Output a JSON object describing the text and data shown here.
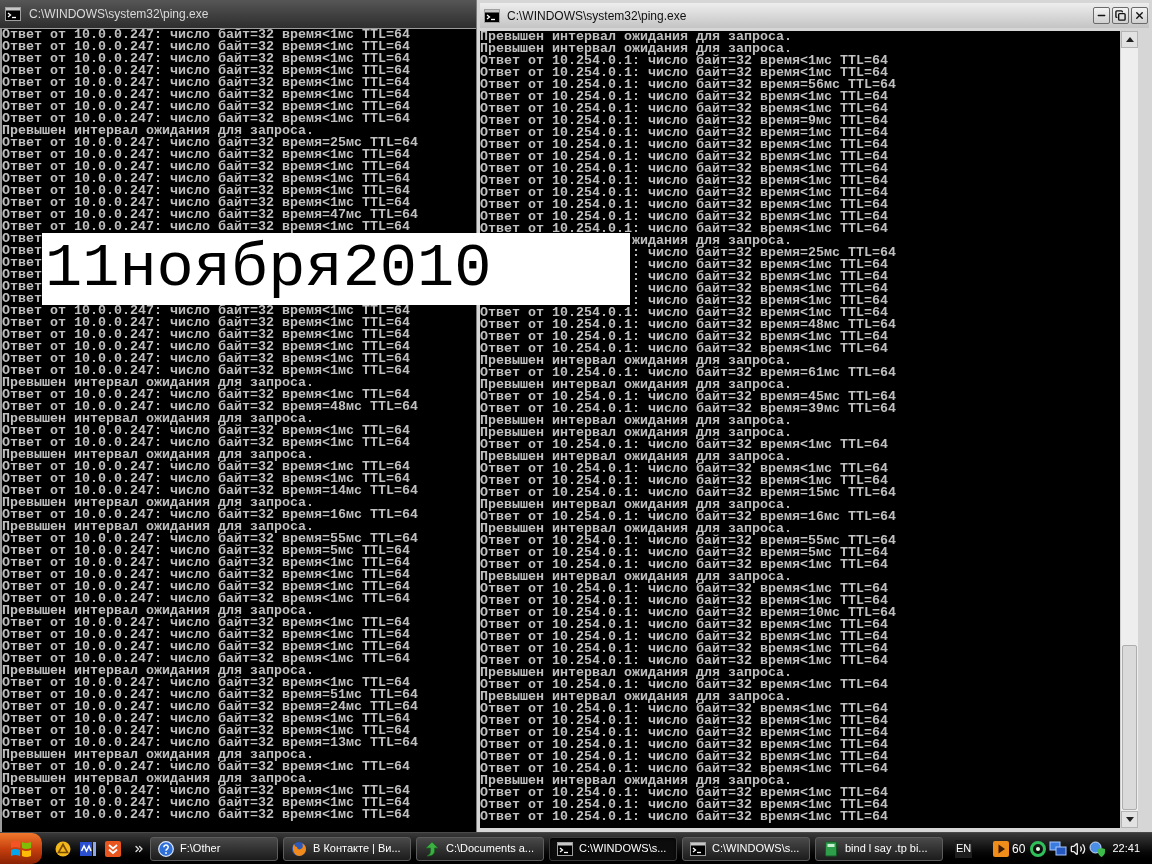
{
  "windows": [
    {
      "title": "C:\\WINDOWS\\system32\\ping.exe",
      "active": false,
      "lines": [
        {
          "kind": "line",
          "text": "Ответ от 10.0.0.247: число байт=32 время<1мс TTL=64"
        },
        {
          "kind": "line",
          "text": "Ответ от 10.0.0.247: число байт=32 время<1мс TTL=64"
        },
        {
          "kind": "line",
          "text": "Ответ от 10.0.0.247: число байт=32 время<1мс TTL=64"
        },
        {
          "kind": "line",
          "text": "Ответ от 10.0.0.247: число байт=32 время<1мс TTL=64"
        },
        {
          "kind": "line",
          "text": "Ответ от 10.0.0.247: число байт=32 время<1мс TTL=64"
        },
        {
          "kind": "line",
          "text": "Ответ от 10.0.0.247: число байт=32 время<1мс TTL=64"
        },
        {
          "kind": "line",
          "text": "Ответ от 10.0.0.247: число байт=32 время<1мс TTL=64"
        },
        {
          "kind": "line",
          "text": "Ответ от 10.0.0.247: число байт=32 время<1мс TTL=64"
        },
        {
          "kind": "line",
          "text": "Превышен интервал ожидания для запроса."
        },
        {
          "kind": "line",
          "text": "Ответ от 10.0.0.247: число байт=32 время=25мс TTL=64"
        },
        {
          "kind": "line",
          "text": "Ответ от 10.0.0.247: число байт=32 время<1мс TTL=64"
        },
        {
          "kind": "line",
          "text": "Ответ от 10.0.0.247: число байт=32 время<1мс TTL=64"
        },
        {
          "kind": "line",
          "text": "Ответ от 10.0.0.247: число байт=32 время<1мс TTL=64"
        },
        {
          "kind": "line",
          "text": "Ответ от 10.0.0.247: число байт=32 время<1мс TTL=64"
        },
        {
          "kind": "line",
          "text": "Ответ от 10.0.0.247: число байт=32 время<1мс TTL=64"
        },
        {
          "kind": "line",
          "text": "Ответ от 10.0.0.247: число байт=32 время=47мс TTL=64"
        },
        {
          "kind": "line",
          "text": "Ответ от 10.0.0.247: число байт=32 время<1мс TTL=64"
        },
        {
          "kind": "line",
          "text": "Ответ"
        },
        {
          "kind": "line",
          "text": "Ответ"
        },
        {
          "kind": "line",
          "text": "Ответ"
        },
        {
          "kind": "line",
          "text": "Ответ"
        },
        {
          "kind": "line",
          "text": "Ответ"
        },
        {
          "kind": "line",
          "text": "Ответ"
        },
        {
          "kind": "line",
          "text": "Ответ от 10.0.0.247: число байт=32 время<1мс TTL=64"
        },
        {
          "kind": "line",
          "text": "Ответ от 10.0.0.247: число байт=32 время<1мс TTL=64"
        },
        {
          "kind": "line",
          "text": "Ответ от 10.0.0.247: число байт=32 время<1мс TTL=64"
        },
        {
          "kind": "line",
          "text": "Ответ от 10.0.0.247: число байт=32 время<1мс TTL=64"
        },
        {
          "kind": "line",
          "text": "Ответ от 10.0.0.247: число байт=32 время<1мс TTL=64"
        },
        {
          "kind": "line",
          "text": "Ответ от 10.0.0.247: число байт=32 время<1мс TTL=64"
        },
        {
          "kind": "line",
          "text": "Превышен интервал ожидания для запроса."
        },
        {
          "kind": "line",
          "text": "Ответ от 10.0.0.247: число байт=32 время<1мс TTL=64"
        },
        {
          "kind": "line",
          "text": "Ответ от 10.0.0.247: число байт=32 время=48мс TTL=64"
        },
        {
          "kind": "line",
          "text": "Превышен интервал ожидания для запроса."
        },
        {
          "kind": "line",
          "text": "Ответ от 10.0.0.247: число байт=32 время<1мс TTL=64"
        },
        {
          "kind": "line",
          "text": "Ответ от 10.0.0.247: число байт=32 время<1мс TTL=64"
        },
        {
          "kind": "line",
          "text": "Превышен интервал ожидания для запроса."
        },
        {
          "kind": "line",
          "text": "Ответ от 10.0.0.247: число байт=32 время<1мс TTL=64"
        },
        {
          "kind": "line",
          "text": "Ответ от 10.0.0.247: число байт=32 время<1мс TTL=64"
        },
        {
          "kind": "line",
          "text": "Ответ от 10.0.0.247: число байт=32 время=14мс TTL=64"
        },
        {
          "kind": "line",
          "text": "Превышен интервал ожидания для запроса."
        },
        {
          "kind": "line",
          "text": "Ответ от 10.0.0.247: число байт=32 время=16мс TTL=64"
        },
        {
          "kind": "line",
          "text": "Превышен интервал ожидания для запроса."
        },
        {
          "kind": "line",
          "text": "Ответ от 10.0.0.247: число байт=32 время=55мс TTL=64"
        },
        {
          "kind": "line",
          "text": "Ответ от 10.0.0.247: число байт=32 время=5мс TTL=64"
        },
        {
          "kind": "line",
          "text": "Ответ от 10.0.0.247: число байт=32 время<1мс TTL=64"
        },
        {
          "kind": "line",
          "text": "Ответ от 10.0.0.247: число байт=32 время<1мс TTL=64"
        },
        {
          "kind": "line",
          "text": "Ответ от 10.0.0.247: число байт=32 время<1мс TTL=64"
        },
        {
          "kind": "line",
          "text": "Ответ от 10.0.0.247: число байт=32 время<1мс TTL=64"
        },
        {
          "kind": "line",
          "text": "Превышен интервал ожидания для запроса."
        },
        {
          "kind": "line",
          "text": "Ответ от 10.0.0.247: число байт=32 время<1мс TTL=64"
        },
        {
          "kind": "line",
          "text": "Ответ от 10.0.0.247: число байт=32 время<1мс TTL=64"
        },
        {
          "kind": "line",
          "text": "Ответ от 10.0.0.247: число байт=32 время<1мс TTL=64"
        },
        {
          "kind": "line",
          "text": "Ответ от 10.0.0.247: число байт=32 время<1мс TTL=64"
        },
        {
          "kind": "line",
          "text": "Превышен интервал ожидания для запроса."
        },
        {
          "kind": "line",
          "text": "Ответ от 10.0.0.247: число байт=32 время<1мс TTL=64"
        },
        {
          "kind": "line",
          "text": "Ответ от 10.0.0.247: число байт=32 время=51мс TTL=64"
        },
        {
          "kind": "line",
          "text": "Ответ от 10.0.0.247: число байт=32 время=24мс TTL=64"
        },
        {
          "kind": "line",
          "text": "Ответ от 10.0.0.247: число байт=32 время<1мс TTL=64"
        },
        {
          "kind": "line",
          "text": "Ответ от 10.0.0.247: число байт=32 время<1мс TTL=64"
        },
        {
          "kind": "line",
          "text": "Ответ от 10.0.0.247: число байт=32 время=13мс TTL=64"
        },
        {
          "kind": "line",
          "text": "Превышен интервал ожидания для запроса."
        },
        {
          "kind": "line",
          "text": "Ответ от 10.0.0.247: число байт=32 время<1мс TTL=64"
        },
        {
          "kind": "line",
          "text": "Превышен интервал ожидания для запроса."
        },
        {
          "kind": "line",
          "text": "Ответ от 10.0.0.247: число байт=32 время<1мс TTL=64"
        },
        {
          "kind": "line",
          "text": "Ответ от 10.0.0.247: число байт=32 время<1мс TTL=64"
        },
        {
          "kind": "line",
          "text": "Ответ от 10.0.0.247: число байт=32 время<1мс TTL=64"
        }
      ]
    },
    {
      "title": "C:\\WINDOWS\\system32\\ping.exe",
      "active": true,
      "lines": [
        {
          "kind": "line",
          "text": "Превышен интервал ожидания для запроса."
        },
        {
          "kind": "line",
          "text": "Превышен интервал ожидания для запроса."
        },
        {
          "kind": "line",
          "text": "Ответ от 10.254.0.1: число байт=32 время<1мс TTL=64"
        },
        {
          "kind": "line",
          "text": "Ответ от 10.254.0.1: число байт=32 время<1мс TTL=64"
        },
        {
          "kind": "line",
          "text": "Ответ от 10.254.0.1: число байт=32 время=56мс TTL=64"
        },
        {
          "kind": "line",
          "text": "Ответ от 10.254.0.1: число байт=32 время<1мс TTL=64"
        },
        {
          "kind": "line",
          "text": "Ответ от 10.254.0.1: число байт=32 время<1мс TTL=64"
        },
        {
          "kind": "line",
          "text": "Ответ от 10.254.0.1: число байт=32 время=9мс TTL=64"
        },
        {
          "kind": "line",
          "text": "Ответ от 10.254.0.1: число байт=32 время=1мс TTL=64"
        },
        {
          "kind": "line",
          "text": "Ответ от 10.254.0.1: число байт=32 время<1мс TTL=64"
        },
        {
          "kind": "line",
          "text": "Ответ от 10.254.0.1: число байт=32 время<1мс TTL=64"
        },
        {
          "kind": "line",
          "text": "Ответ от 10.254.0.1: число байт=32 время<1мс TTL=64"
        },
        {
          "kind": "line",
          "text": "Ответ от 10.254.0.1: число байт=32 время<1мс TTL=64"
        },
        {
          "kind": "line",
          "text": "Ответ от 10.254.0.1: число байт=32 время<1мс TTL=64"
        },
        {
          "kind": "line",
          "text": "Ответ от 10.254.0.1: число байт=32 время<1мс TTL=64"
        },
        {
          "kind": "line",
          "text": "Ответ от 10.254.0.1: число байт=32 время<1мс TTL=64"
        },
        {
          "kind": "line",
          "text": "Ответ от 10.254.0.1: число байт=32 время<1мс TTL=64"
        },
        {
          "kind": "tail",
          "text": "жидания для запроса."
        },
        {
          "kind": "tail",
          "text": ": число байт=32 время=25мс TTL=64"
        },
        {
          "kind": "tail",
          "text": ": число байт=32 время<1мс TTL=64"
        },
        {
          "kind": "tail",
          "text": ": число байт=32 время<1мс TTL=64"
        },
        {
          "kind": "tail",
          "text": ": число байт=32 время<1мс TTL=64"
        },
        {
          "kind": "tail",
          "text": ": число байт=32 время<1мс TTL=64"
        },
        {
          "kind": "line",
          "text": "Ответ от 10.254.0.1: число байт=32 время<1мс TTL=64"
        },
        {
          "kind": "line",
          "text": "Ответ от 10.254.0.1: число байт=32 время=48мс TTL=64"
        },
        {
          "kind": "line",
          "text": "Ответ от 10.254.0.1: число байт=32 время<1мс TTL=64"
        },
        {
          "kind": "line",
          "text": "Ответ от 10.254.0.1: число байт=32 время<1мс TTL=64"
        },
        {
          "kind": "line",
          "text": "Превышен интервал ожидания для запроса."
        },
        {
          "kind": "line",
          "text": "Ответ от 10.254.0.1: число байт=32 время=61мс TTL=64"
        },
        {
          "kind": "line",
          "text": "Превышен интервал ожидания для запроса."
        },
        {
          "kind": "line",
          "text": "Ответ от 10.254.0.1: число байт=32 время=45мс TTL=64"
        },
        {
          "kind": "line",
          "text": "Ответ от 10.254.0.1: число байт=32 время=39мс TTL=64"
        },
        {
          "kind": "line",
          "text": "Превышен интервал ожидания для запроса."
        },
        {
          "kind": "line",
          "text": "Превышен интервал ожидания для запроса."
        },
        {
          "kind": "line",
          "text": "Ответ от 10.254.0.1: число байт=32 время<1мс TTL=64"
        },
        {
          "kind": "line",
          "text": "Превышен интервал ожидания для запроса."
        },
        {
          "kind": "line",
          "text": "Ответ от 10.254.0.1: число байт=32 время<1мс TTL=64"
        },
        {
          "kind": "line",
          "text": "Ответ от 10.254.0.1: число байт=32 время<1мс TTL=64"
        },
        {
          "kind": "line",
          "text": "Ответ от 10.254.0.1: число байт=32 время=15мс TTL=64"
        },
        {
          "kind": "line",
          "text": "Превышен интервал ожидания для запроса."
        },
        {
          "kind": "line",
          "text": "Ответ от 10.254.0.1: число байт=32 время=16мс TTL=64"
        },
        {
          "kind": "line",
          "text": "Превышен интервал ожидания для запроса."
        },
        {
          "kind": "line",
          "text": "Ответ от 10.254.0.1: число байт=32 время=55мс TTL=64"
        },
        {
          "kind": "line",
          "text": "Ответ от 10.254.0.1: число байт=32 время=5мс TTL=64"
        },
        {
          "kind": "line",
          "text": "Ответ от 10.254.0.1: число байт=32 время<1мс TTL=64"
        },
        {
          "kind": "line",
          "text": "Превышен интервал ожидания для запроса."
        },
        {
          "kind": "line",
          "text": "Ответ от 10.254.0.1: число байт=32 время<1мс TTL=64"
        },
        {
          "kind": "line",
          "text": "Ответ от 10.254.0.1: число байт=32 время<1мс TTL=64"
        },
        {
          "kind": "line",
          "text": "Ответ от 10.254.0.1: число байт=32 время=10мс TTL=64"
        },
        {
          "kind": "line",
          "text": "Ответ от 10.254.0.1: число байт=32 время<1мс TTL=64"
        },
        {
          "kind": "line",
          "text": "Ответ от 10.254.0.1: число байт=32 время<1мс TTL=64"
        },
        {
          "kind": "line",
          "text": "Ответ от 10.254.0.1: число байт=32 время<1мс TTL=64"
        },
        {
          "kind": "line",
          "text": "Ответ от 10.254.0.1: число байт=32 время<1мс TTL=64"
        },
        {
          "kind": "line",
          "text": "Превышен интервал ожидания для запроса."
        },
        {
          "kind": "line",
          "text": "Ответ от 10.254.0.1: число байт=32 время<1мс TTL=64"
        },
        {
          "kind": "line",
          "text": "Превышен интервал ожидания для запроса."
        },
        {
          "kind": "line",
          "text": "Ответ от 10.254.0.1: число байт=32 время<1мс TTL=64"
        },
        {
          "kind": "line",
          "text": "Ответ от 10.254.0.1: число байт=32 время<1мс TTL=64"
        },
        {
          "kind": "line",
          "text": "Ответ от 10.254.0.1: число байт=32 время<1мс TTL=64"
        },
        {
          "kind": "line",
          "text": "Ответ от 10.254.0.1: число байт=32 время<1мс TTL=64"
        },
        {
          "kind": "line",
          "text": "Ответ от 10.254.0.1: число байт=32 время<1мс TTL=64"
        },
        {
          "kind": "line",
          "text": "Ответ от 10.254.0.1: число байт=32 время<1мс TTL=64"
        },
        {
          "kind": "line",
          "text": "Превышен интервал ожидания для запроса."
        },
        {
          "kind": "line",
          "text": "Ответ от 10.254.0.1: число байт=32 время<1мс TTL=64"
        },
        {
          "kind": "line",
          "text": "Ответ от 10.254.0.1: число байт=32 время<1мс TTL=64"
        },
        {
          "kind": "line",
          "text": "Ответ от 10.254.0.1: число байт=32 время<1мс TTL=64"
        }
      ]
    }
  ],
  "caption": {
    "text": "11ноября2010"
  },
  "taskbar": {
    "tasks": [
      {
        "label": "F:\\Other",
        "selected": false
      },
      {
        "label": "В Контакте | Ви...",
        "selected": false
      },
      {
        "label": "C:\\Documents a...",
        "selected": false
      },
      {
        "label": "C:\\WINDOWS\\s...",
        "selected": true
      },
      {
        "label": "C:\\WINDOWS\\s...",
        "selected": false
      },
      {
        "label": "bind l say .tp bi...",
        "selected": false
      }
    ],
    "language": "EN",
    "tray_reading": "60",
    "clock": "22:41"
  }
}
